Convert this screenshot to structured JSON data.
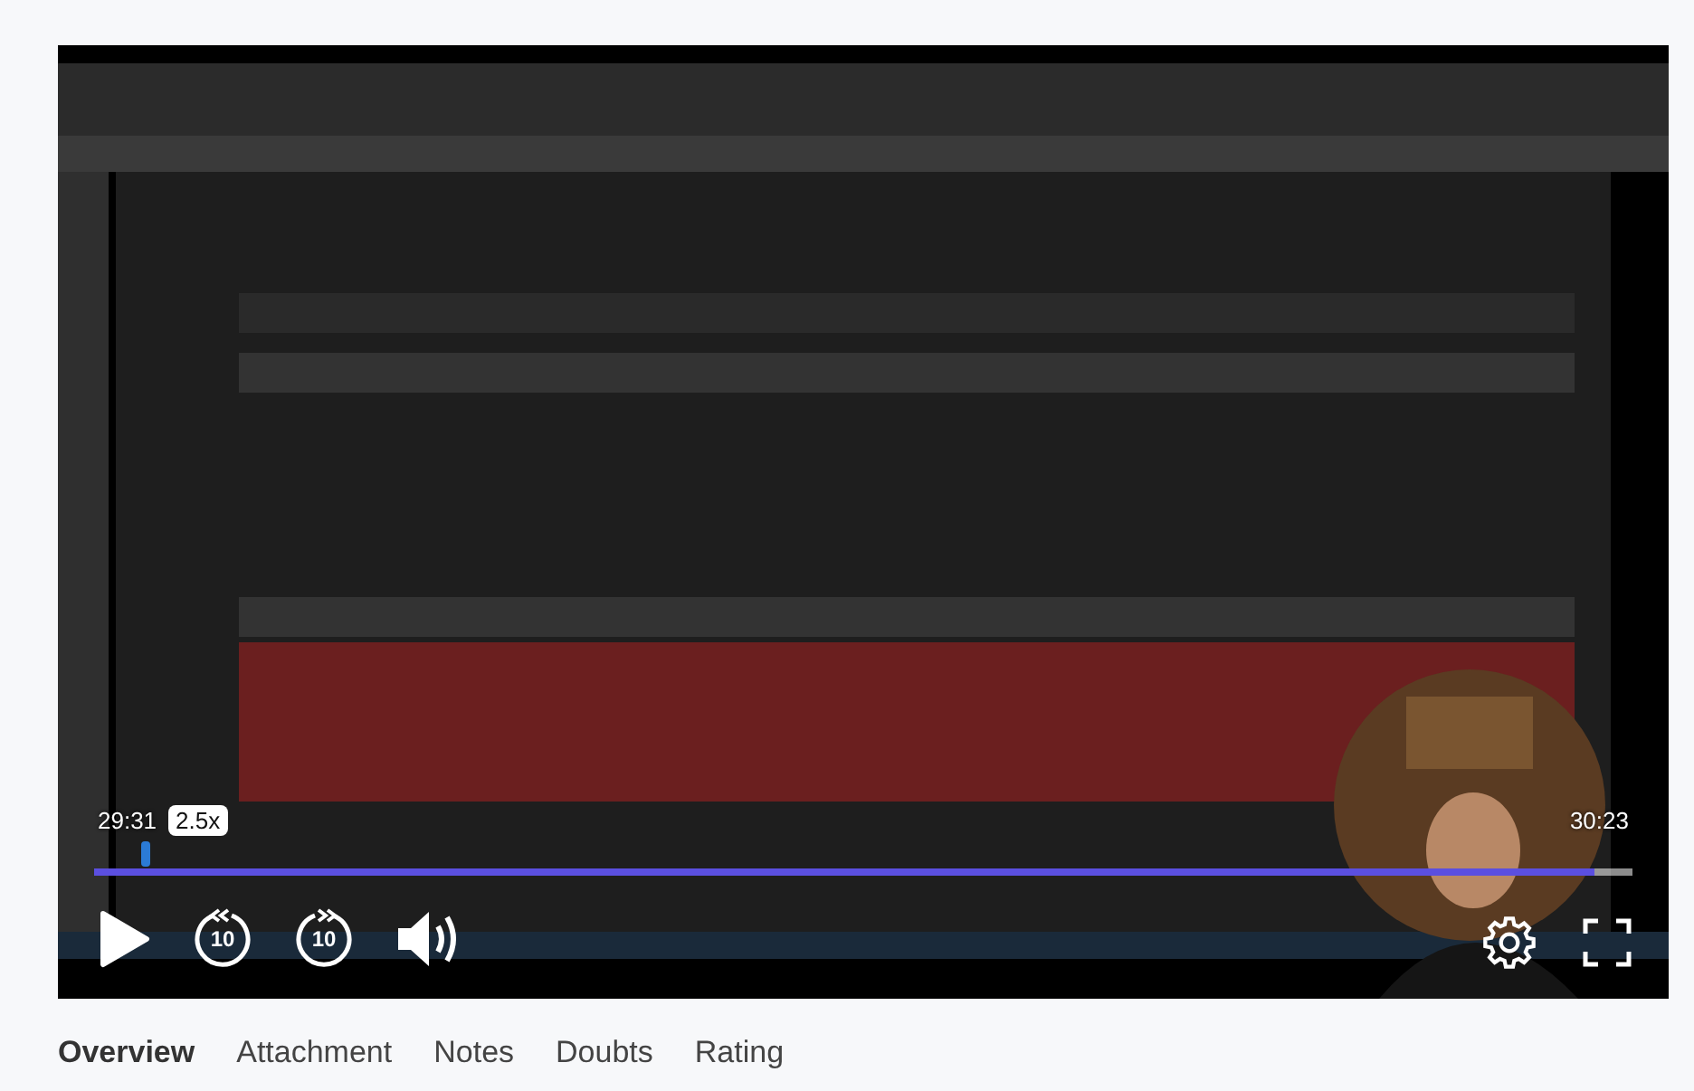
{
  "player": {
    "elapsed": "29:31",
    "speed": "2.5x",
    "duration": "30:23",
    "progress": {
      "level": 0.975
    },
    "rewind_label": "10",
    "forward_label": "10"
  },
  "tabs": [
    {
      "label": "Overview",
      "selected": true
    },
    {
      "label": "Attachment",
      "selected": false
    },
    {
      "label": "Notes",
      "selected": false
    },
    {
      "label": "Doubts",
      "selected": false
    },
    {
      "label": "Rating",
      "selected": false
    }
  ]
}
